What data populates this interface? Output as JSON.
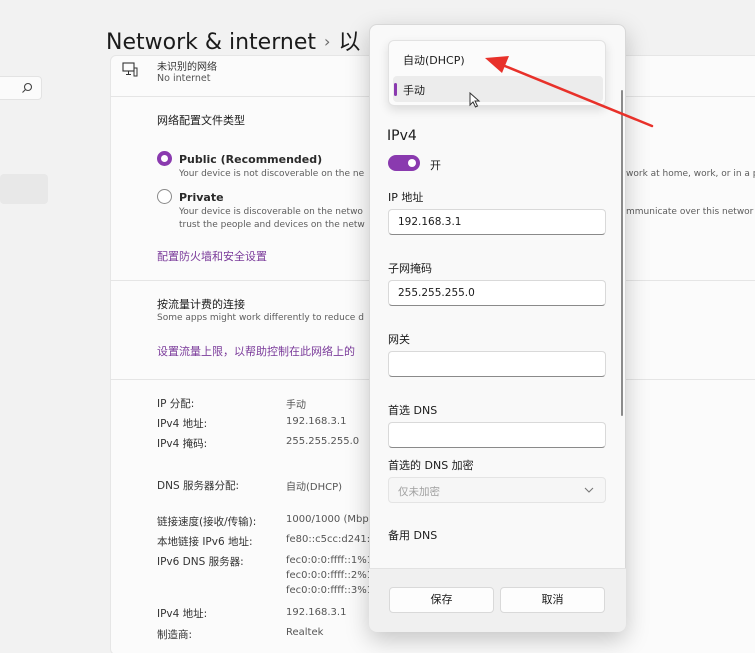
{
  "header": {
    "title": "Network & internet",
    "separator": "›",
    "title_tail": "以"
  },
  "network": {
    "name": "未识别的网络",
    "status": "No internet"
  },
  "profile": {
    "heading": "网络配置文件类型",
    "public": {
      "label": "Public (Recommended)",
      "desc": "Your device is not discoverable on the ne",
      "desc_right": "work at home, work, or in a p"
    },
    "private": {
      "label": "Private",
      "desc1": "Your device is discoverable on the netwo",
      "desc2": "trust the people and devices on the netw",
      "desc_right": "mmunicate over this networ"
    },
    "firewall_link": "配置防火墙和安全设置"
  },
  "metered": {
    "heading": "按流量计费的连接",
    "desc": "Some apps might work differently to reduce d",
    "link": "设置流量上限，以帮助控制在此网络上的"
  },
  "properties": [
    {
      "key": "IP 分配:",
      "value": "手动"
    },
    {
      "key": "IPv4 地址:",
      "value": "192.168.3.1"
    },
    {
      "key": "IPv4 掩码:",
      "value": "255.255.255.0"
    },
    {
      "key": "DNS 服务器分配:",
      "value": "自动(DHCP)"
    },
    {
      "key": "链接速度(接收/传输):",
      "value": "1000/1000 (Mbp"
    },
    {
      "key": "本地链接 IPv6 地址:",
      "value": "fe80::c5cc:d241:a"
    },
    {
      "key": "IPv6 DNS 服务器:",
      "value": "fec0:0:0:ffff::1%1"
    },
    {
      "key": "",
      "value": "fec0:0:0:ffff::2%1"
    },
    {
      "key": "",
      "value": "fec0:0:0:ffff::3%1"
    },
    {
      "key": "IPv4 地址:",
      "value": "192.168.3.1"
    },
    {
      "key": "制造商:",
      "value": "Realtek"
    }
  ],
  "dialog": {
    "dropdown_options": [
      "自动(DHCP)",
      "手动"
    ],
    "dropdown_selected_index": 1,
    "section": "IPv4",
    "toggle_label": "开",
    "toggle_on": true,
    "ip_label": "IP 地址",
    "ip_value": "192.168.3.1",
    "mask_label": "子网掩码",
    "mask_value": "255.255.255.0",
    "gateway_label": "网关",
    "gateway_value": "",
    "dns_label": "首选 DNS",
    "dns_value": "",
    "dns_enc_label": "首选的 DNS 加密",
    "dns_enc_value": "仅未加密",
    "alt_dns_label": "备用 DNS",
    "save": "保存",
    "cancel": "取消"
  },
  "colors": {
    "accent": "#8a3aaf",
    "annotation_arrow": "#e8312a"
  },
  "icons": {
    "search": "search-icon",
    "pc": "pc-icon",
    "chevron": "chevron-down-icon",
    "cursor": "mouse-cursor-icon"
  }
}
